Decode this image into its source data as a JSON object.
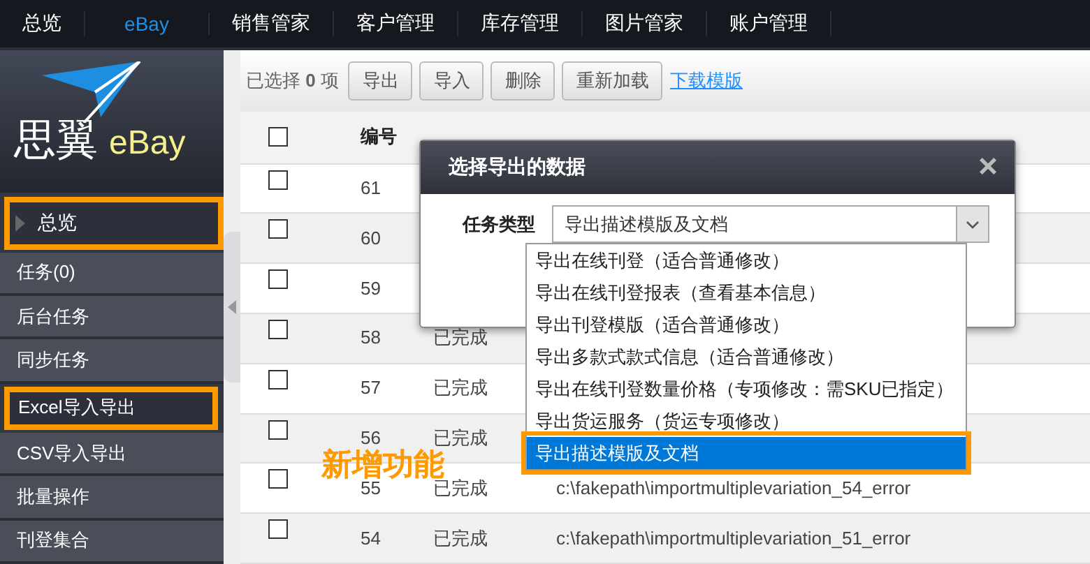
{
  "nav": [
    {
      "label": "总览",
      "selected": false
    },
    {
      "label": "eBay",
      "selected": true
    },
    {
      "label": "销售管家",
      "selected": false
    },
    {
      "label": "客户管理",
      "selected": false
    },
    {
      "label": "库存管理",
      "selected": false
    },
    {
      "label": "图片管家",
      "selected": false
    },
    {
      "label": "账户管理",
      "selected": false
    }
  ],
  "logo": {
    "brand": "思翼",
    "product": "eBay"
  },
  "sidebar": {
    "items": [
      {
        "label": "总览",
        "kind": "header",
        "selected": true,
        "annotated": true
      },
      {
        "label": "任务(0)",
        "kind": "item",
        "selected": false,
        "annotated": false
      },
      {
        "label": "后台任务",
        "kind": "item",
        "selected": false,
        "annotated": false
      },
      {
        "label": "同步任务",
        "kind": "item",
        "selected": false,
        "annotated": false
      },
      {
        "label": "Excel导入导出",
        "kind": "item",
        "selected": true,
        "annotated": true
      },
      {
        "label": "CSV导入导出",
        "kind": "item",
        "selected": false,
        "annotated": false
      },
      {
        "label": "批量操作",
        "kind": "item",
        "selected": false,
        "annotated": false
      },
      {
        "label": "刊登集合",
        "kind": "item",
        "selected": false,
        "annotated": false
      }
    ]
  },
  "toolbar": {
    "selection": "已选择 **0** 项",
    "buttons": [
      "导出",
      "导入",
      "删除",
      "重新加载"
    ],
    "link": "下载模版"
  },
  "table": {
    "select_all_checked": false,
    "columns": [
      "编号"
    ],
    "rows": [
      {
        "checked": false,
        "number": "61"
      },
      {
        "checked": false,
        "number": "60"
      },
      {
        "checked": false,
        "number": "59"
      },
      {
        "checked": false,
        "number": "58",
        "status": "已完成"
      },
      {
        "checked": false,
        "number": "57",
        "status": "已完成"
      },
      {
        "checked": false,
        "number": "56",
        "status": "已完成"
      },
      {
        "checked": false,
        "number": "55",
        "status": "已完成",
        "name": "c:\\fakepath\\importmultiplevariation_54_error"
      },
      {
        "checked": false,
        "number": "54",
        "status": "已完成",
        "name": "c:\\fakepath\\importmultiplevariation_51_error"
      }
    ]
  },
  "dialog": {
    "title": "选择导出的数据",
    "close": "×",
    "field_label": "任务类型",
    "value": "导出描述模版及文档",
    "options": [
      {
        "label": "导出在线刊登（适合普通修改）",
        "selected": false,
        "annotated": false
      },
      {
        "label": "导出在线刊登报表（查看基本信息）",
        "selected": false,
        "annotated": false
      },
      {
        "label": "导出刊登模版（适合普通修改）",
        "selected": false,
        "annotated": false
      },
      {
        "label": "导出多款式款式信息（适合普通修改）",
        "selected": false,
        "annotated": false
      },
      {
        "label": "导出在线刊登数量价格（专项修改：需SKU已指定）",
        "selected": false,
        "annotated": false
      },
      {
        "label": "导出货运服务（货运专项修改）",
        "selected": false,
        "annotated": false
      },
      {
        "label": "导出描述模版及文档",
        "selected": true,
        "annotated": true
      }
    ]
  },
  "annotation": "新增功能"
}
